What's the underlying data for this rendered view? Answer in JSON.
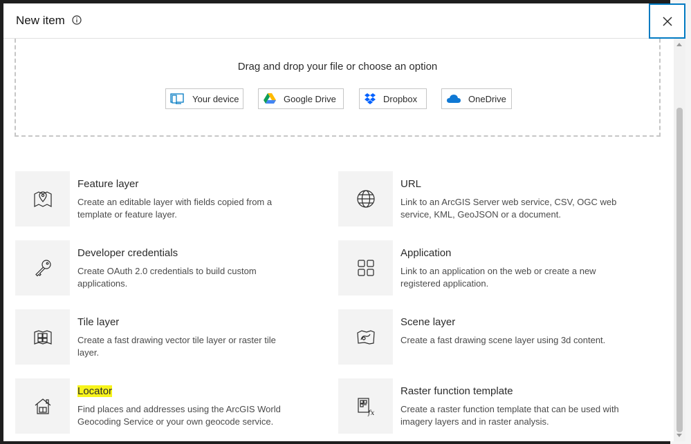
{
  "dialog": {
    "title": "New item",
    "info_icon": "info-icon",
    "close_icon": "close-icon",
    "accent_color": "#007ac2"
  },
  "dropzone": {
    "prompt": "Drag and drop your file or choose an option",
    "sources": [
      {
        "label": "Your device",
        "icon": "device-icon"
      },
      {
        "label": "Google Drive",
        "icon": "google-drive-icon"
      },
      {
        "label": "Dropbox",
        "icon": "dropbox-icon"
      },
      {
        "label": "OneDrive",
        "icon": "onedrive-icon"
      }
    ]
  },
  "items": [
    {
      "title": "Feature layer",
      "description": "Create an editable layer with fields copied from a template or feature layer.",
      "icon": "map-pin-icon"
    },
    {
      "title": "URL",
      "description": "Link to an ArcGIS Server web service, CSV, OGC web service, KML, GeoJSON or a document.",
      "icon": "globe-icon"
    },
    {
      "title": "Developer credentials",
      "description": "Create OAuth 2.0 credentials to build custom applications.",
      "icon": "key-icon"
    },
    {
      "title": "Application",
      "description": "Link to an application on the web or create a new registered application.",
      "icon": "apps-grid-icon"
    },
    {
      "title": "Tile layer",
      "description": "Create a fast drawing vector tile layer or raster tile layer.",
      "icon": "tile-layer-icon"
    },
    {
      "title": "Scene layer",
      "description": "Create a fast drawing scene layer using 3d content.",
      "icon": "scene-layer-icon"
    },
    {
      "title": "Locator",
      "description": "Find places and addresses using the ArcGIS World Geocoding Service or your own geocode service.",
      "icon": "locator-icon",
      "highlight_color": "#f7f31b"
    },
    {
      "title": "Raster function template",
      "description": "Create a raster function template that can be used with imagery layers and in raster analysis.",
      "icon": "raster-function-icon"
    }
  ]
}
